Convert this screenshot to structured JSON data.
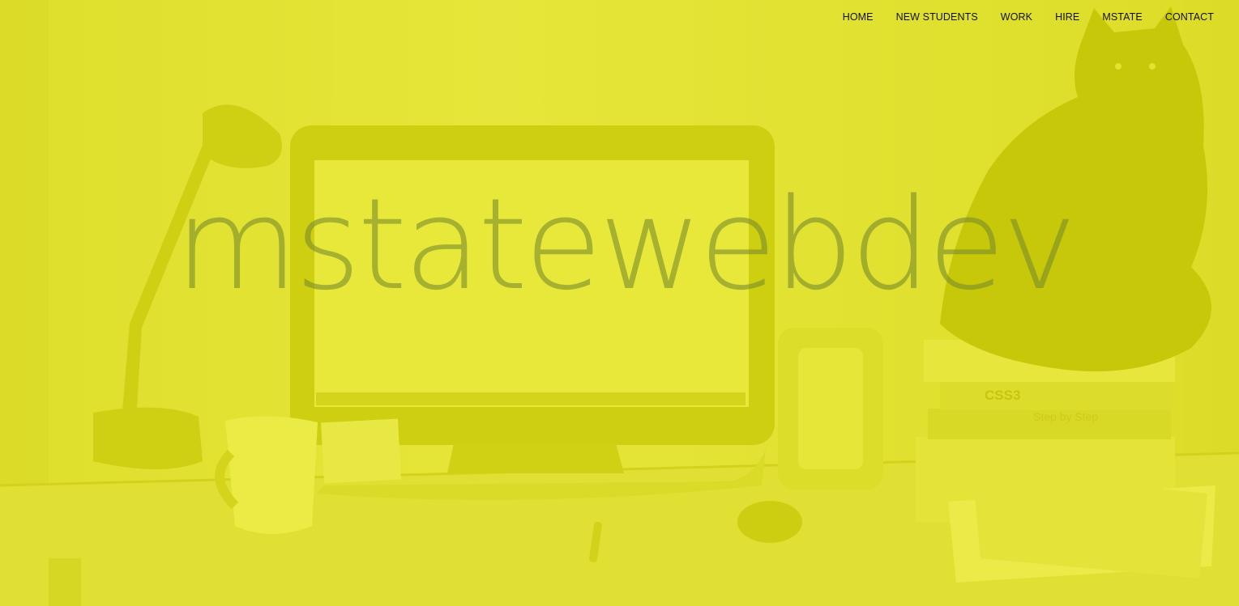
{
  "nav": {
    "items": [
      "HOME",
      "NEW STUDENTS",
      "WORK",
      "HIRE",
      "MSTATE",
      "CONTACT"
    ]
  },
  "hero": {
    "title": "mstatewebdev",
    "book_label": "CSS3",
    "book_label_2": "Step by Step"
  },
  "colors": {
    "overlay": "#e2e230",
    "title": "#8c9a3a",
    "nav_text": "#111111"
  }
}
